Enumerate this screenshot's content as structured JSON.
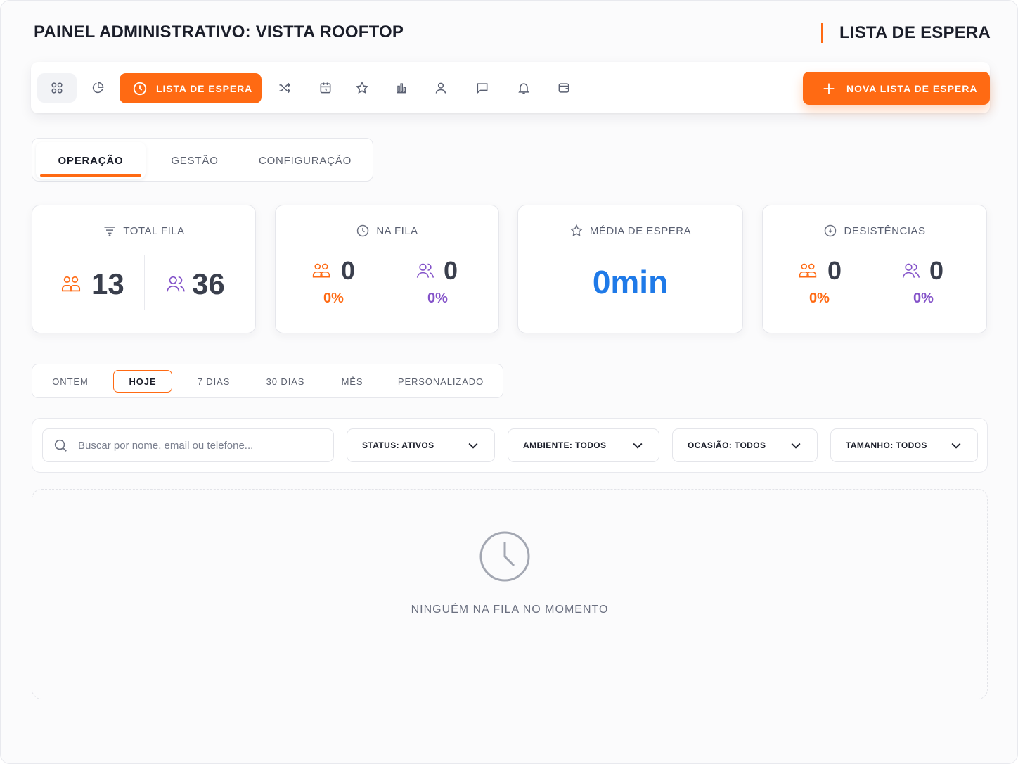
{
  "header": {
    "title": "PAINEL ADMINISTRATIVO: VISTTA ROOFTOP",
    "section": "LISTA DE ESPERA"
  },
  "toolbar": {
    "icons": [
      "grid-icon",
      "pie-chart-icon",
      "clock-icon",
      "shuffle-icon",
      "calendar-icon",
      "star-icon",
      "bar-chart-icon",
      "user-icon",
      "chat-icon",
      "bell-icon",
      "wallet-icon"
    ],
    "active_label": "LISTA DE ESPERA",
    "new_button_label": "NOVA LISTA DE ESPERA"
  },
  "tabs": [
    {
      "label": "OPERAÇÃO",
      "active": true
    },
    {
      "label": "GESTÃO",
      "active": false
    },
    {
      "label": "CONFIGURAÇÃO",
      "active": false
    }
  ],
  "stats": {
    "total_fila": {
      "title": "TOTAL FILA",
      "left_value": "13",
      "right_value": "36"
    },
    "na_fila": {
      "title": "NA FILA",
      "left_value": "0",
      "left_pct": "0%",
      "right_value": "0",
      "right_pct": "0%"
    },
    "media_espera": {
      "title": "MÉDIA DE ESPERA",
      "value": "0min"
    },
    "desistencias": {
      "title": "DESISTÊNCIAS",
      "left_value": "0",
      "left_pct": "0%",
      "right_value": "0",
      "right_pct": "0%"
    }
  },
  "period": {
    "options": [
      "ONTEM",
      "HOJE",
      "7 DIAS",
      "30 DIAS",
      "MÊS",
      "PERSONALIZADO"
    ],
    "selected": "HOJE"
  },
  "filters": {
    "search_placeholder": "Buscar por nome, email ou telefone...",
    "status": "STATUS: ATIVOS",
    "ambiente": "AMBIENTE: TODOS",
    "ocasiao": "OCASIÃO: TODOS",
    "tamanho": "TAMANHO: TODOS"
  },
  "empty_state": {
    "message": "NINGUÉM NA FILA NO MOMENTO"
  },
  "colors": {
    "accent": "#ff6a13",
    "primary_blue": "#1f7ae8",
    "purple": "#8453c9"
  }
}
